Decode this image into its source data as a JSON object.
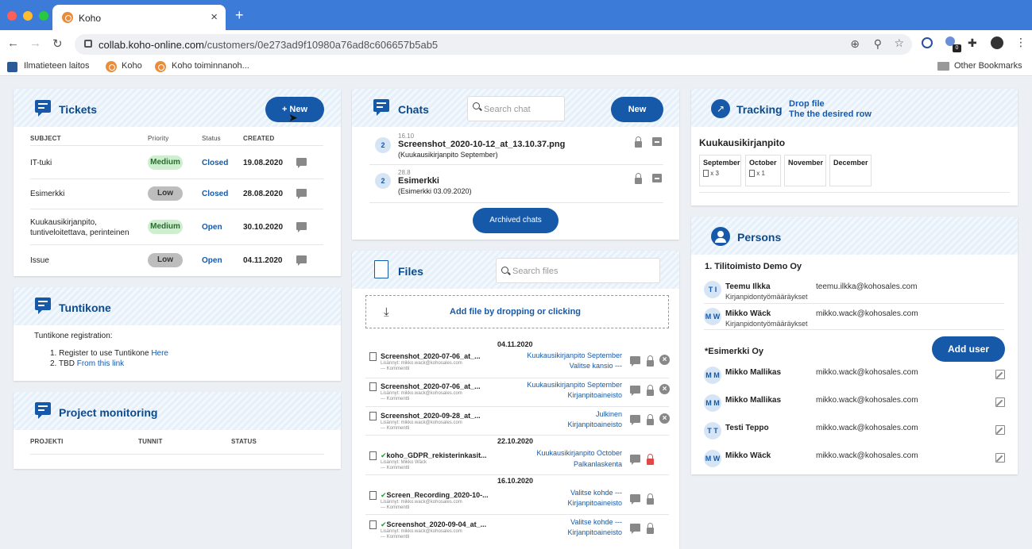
{
  "browser": {
    "tab_title": "Koho",
    "url_host": "collab.koho-online.com",
    "url_path": "/customers/0e273ad9f10980a76ad8c606657b5ab5",
    "extension_badge": "0",
    "bookmarks": [
      "Ilmatieteen laitos",
      "Koho",
      "Koho toiminnanoh..."
    ],
    "other_bookmarks": "Other Bookmarks"
  },
  "tickets": {
    "title": "Tickets",
    "new_button": "+ New",
    "columns": [
      "SUBJECT",
      "Priority",
      "Status",
      "CREATED"
    ],
    "rows": [
      {
        "subject": "IT-tuki",
        "priority": "Medium",
        "status": "Closed",
        "created": "19.08.2020"
      },
      {
        "subject": "Esimerkki",
        "priority": "Low",
        "status": "Closed",
        "created": "28.08.2020"
      },
      {
        "subject": "Kuukausikirjanpito,",
        "subject2": "tuntiveloitettava, perinteinen",
        "priority": "Medium",
        "status": "Open",
        "created": "30.10.2020"
      },
      {
        "subject": "Issue",
        "priority": "Low",
        "status": "Open",
        "created": "04.11.2020"
      }
    ]
  },
  "tuntikone": {
    "title": "Tuntikone",
    "intro": "Tuntikone registration:",
    "step1": "1. Register to use Tuntikone",
    "step1_link": "Here",
    "step2": "2. TBD",
    "step2_link": "From this link"
  },
  "project_monitoring": {
    "title": "Project monitoring",
    "columns": [
      "PROJEKTI",
      "TUNNIT",
      "STATUS"
    ]
  },
  "chats": {
    "title": "Chats",
    "search_placeholder": "Search chat",
    "new_button": "New",
    "items": [
      {
        "count": "2",
        "date": "16.10",
        "name": "Screenshot_2020-10-12_at_13.10.37.png",
        "sub": "(Kuukausikirjanpito September)"
      },
      {
        "count": "2",
        "date": "28.8",
        "name": "Esimerkki",
        "sub": "(Esimerkki 03.09.2020)"
      }
    ],
    "archived_button": "Archived chats"
  },
  "files": {
    "title": "Files",
    "search_placeholder": "Search files",
    "drop_text": "Add file by dropping or clicking",
    "date_1": "04.11.2020",
    "date_2": "22.10.2020",
    "date_3": "16.10.2020",
    "items": [
      {
        "name": "Screenshot_2020-07-06_at_...",
        "meta": "Lisännyt: mikko.wack@kohosales.com",
        "comment": "--- Kommentti",
        "cat1": "Kuukausikirjanpito September",
        "cat2": "Valitse kansio ---"
      },
      {
        "name": "Screenshot_2020-07-06_at_...",
        "meta": "Lisännyt: mikko.wack@kohosales.com",
        "comment": "--- Kommentti",
        "cat1": "Kuukausikirjanpito September",
        "cat2": "Kirjanpitoaineisto"
      },
      {
        "name": "Screenshot_2020-09-28_at_...",
        "meta": "Lisännyt: mikko.wack@kohosales.com",
        "comment": "--- Kommentti",
        "cat1": "Julkinen",
        "cat2": "Kirjanpitoaineisto"
      },
      {
        "name": "koho_GDPR_rekisterinkasit...",
        "meta": "Lisännyt: Mikko Wäck",
        "comment": "--- Kommentti",
        "cat1": "Kuukausikirjanpito October",
        "cat2": "Palkanlaskenta"
      },
      {
        "name": "Screen_Recording_2020-10-...",
        "meta": "Lisännyt: mikko.wack@kohosales.com",
        "comment": "--- Kommentti",
        "cat1": "Valitse kohde ---",
        "cat2": "Kirjanpitoaineisto"
      },
      {
        "name": "Screenshot_2020-09-04_at_...",
        "meta": "Lisännyt: mikko.wack@kohosales.com",
        "comment": "--- Kommentti",
        "cat1": "Valitse kohde ---",
        "cat2": "Kirjanpitoaineisto"
      }
    ]
  },
  "tracking": {
    "title": "Tracking",
    "drop_line1": "Drop file",
    "drop_line2": "The the desired row",
    "row_title": "Kuukausikirjanpito",
    "months": [
      {
        "name": "September",
        "count": "x 3"
      },
      {
        "name": "October",
        "count": "x 1"
      },
      {
        "name": "November",
        "count": ""
      },
      {
        "name": "December",
        "count": ""
      }
    ]
  },
  "persons": {
    "title": "Persons",
    "group1": "1. Tilitoimisto Demo Oy",
    "group2": "*Esimerkki Oy",
    "add_user": "Add user",
    "g1": [
      {
        "initials": "T I",
        "name": "Teemu Ilkka",
        "role": "Kirjanpidontyömääräykset",
        "email": "teemu.ilkka@kohosales.com"
      },
      {
        "initials": "M W",
        "name": "Mikko Wäck",
        "role": "Kirjanpidontyömääräykset",
        "email": "mikko.wack@kohosales.com"
      }
    ],
    "g2": [
      {
        "initials": "M M",
        "name": "Mikko Mallikas",
        "email": "mikko.wack@kohosales.com"
      },
      {
        "initials": "M M",
        "name": "Mikko Mallikas",
        "email": "mikko.wack@kohosales.com"
      },
      {
        "initials": "T T",
        "name": "Testi Teppo",
        "email": "mikko.wack@kohosales.com"
      },
      {
        "initials": "M W",
        "name": "Mikko Wäck",
        "email": "mikko.wack@kohosales.com"
      }
    ]
  },
  "colors": {
    "brand": "#1659a9",
    "chrome": "#3c7bd7",
    "medium": "#cdeecf",
    "low": "#bdbdbd",
    "danger": "#e04848"
  }
}
